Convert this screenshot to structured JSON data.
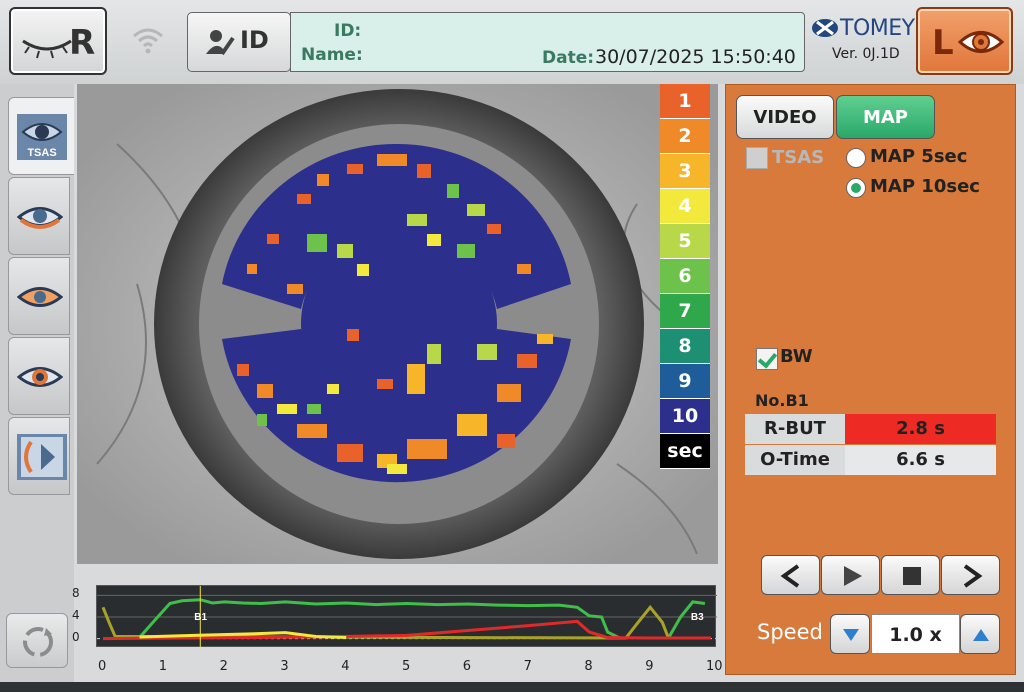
{
  "header": {
    "right_eye_label": "R",
    "left_eye_label": "L",
    "id_button_label": "ID",
    "id_label": "ID:",
    "name_label": "Name:",
    "id_value": "",
    "name_value": "",
    "date_label": "Date:",
    "date_value": "30/07/2025 15:50:40",
    "brand": "TOMEY",
    "version": "Ver. 0J.1D"
  },
  "sidebar": {
    "tsas_label": "TSAS",
    "tools": [
      "tsas-tool-icon",
      "eye-upper-icon",
      "eye-lower-icon",
      "eye-iris-icon",
      "video-meibo-icon"
    ]
  },
  "legend": {
    "items": [
      {
        "label": "1",
        "color": "#e8622a"
      },
      {
        "label": "2",
        "color": "#f08a28"
      },
      {
        "label": "3",
        "color": "#f7b52a"
      },
      {
        "label": "4",
        "color": "#f3e83c"
      },
      {
        "label": "5",
        "color": "#b8d84a"
      },
      {
        "label": "6",
        "color": "#6cc24a"
      },
      {
        "label": "7",
        "color": "#2ea84a"
      },
      {
        "label": "8",
        "color": "#1d8f72"
      },
      {
        "label": "9",
        "color": "#1f5d9a"
      },
      {
        "label": "10",
        "color": "#2d2f8c"
      },
      {
        "label": "sec",
        "color": "#000000"
      }
    ]
  },
  "mode": {
    "video_label": "VIDEO",
    "map_label": "MAP",
    "tsas_label": "TSAS",
    "map5_label": "MAP 5sec",
    "map10_label": "MAP 10sec",
    "selected": "MAP 10sec"
  },
  "bw": {
    "label": "BW",
    "checked": true
  },
  "results": {
    "no_label": "No.B1",
    "rbut_label": "R-BUT",
    "rbut_value": "2.8 s",
    "otime_label": "O-Time",
    "otime_value": "6.6 s"
  },
  "speed": {
    "label": "Speed",
    "value": "1.0 x"
  },
  "chart_data": {
    "type": "line",
    "x_ticks": [
      "0",
      "1",
      "2",
      "3",
      "4",
      "5",
      "6",
      "7",
      "8",
      "9",
      "10"
    ],
    "y_ticks": [
      "8",
      "4",
      "0"
    ],
    "xlim": [
      0,
      10
    ],
    "ylim": [
      -1,
      9
    ],
    "markers": [
      {
        "label": "B1",
        "x": 1.6
      },
      {
        "label": "B3",
        "x": 9.9
      }
    ],
    "series": [
      {
        "color": "#3fbf4a",
        "values": [
          [
            0.6,
            0.2
          ],
          [
            0.9,
            4
          ],
          [
            1.1,
            6.5
          ],
          [
            1.3,
            7
          ],
          [
            1.6,
            7.2
          ],
          [
            1.8,
            6.6
          ],
          [
            2,
            6.8
          ],
          [
            2.3,
            6.6
          ],
          [
            2.6,
            6.5
          ],
          [
            3,
            6.8
          ],
          [
            3.5,
            6.4
          ],
          [
            4,
            6.6
          ],
          [
            4.5,
            6.3
          ],
          [
            5,
            6.5
          ],
          [
            5.5,
            6.3
          ],
          [
            6,
            6.4
          ],
          [
            6.5,
            6.2
          ],
          [
            7,
            6.1
          ],
          [
            7.5,
            6.2
          ],
          [
            7.8,
            5.8
          ],
          [
            8,
            4.2
          ],
          [
            8.2,
            4.0
          ],
          [
            8.3,
            1.2
          ],
          [
            8.5,
            0.1
          ],
          [
            8.6,
            0.1
          ]
        ]
      },
      {
        "color": "#3fbf4a",
        "values": [
          [
            9.3,
            0.1
          ],
          [
            9.5,
            4
          ],
          [
            9.7,
            6.8
          ],
          [
            9.9,
            6.5
          ]
        ]
      },
      {
        "color": "#a8a22a",
        "values": [
          [
            0,
            5.8
          ],
          [
            0.1,
            3
          ],
          [
            0.2,
            0.4
          ],
          [
            8.6,
            0.1
          ],
          [
            8.8,
            3
          ],
          [
            9,
            5.8
          ],
          [
            9.2,
            3
          ],
          [
            9.3,
            0.1
          ]
        ]
      },
      {
        "color": "#e02a2a",
        "values": [
          [
            0,
            0
          ],
          [
            3.5,
            0.3
          ],
          [
            5,
            0.6
          ],
          [
            6,
            1.5
          ],
          [
            7,
            2.4
          ],
          [
            7.5,
            2.9
          ],
          [
            7.8,
            3.2
          ],
          [
            8,
            1.2
          ],
          [
            8.3,
            0.2
          ],
          [
            9,
            0.1
          ],
          [
            10,
            0.1
          ]
        ]
      },
      {
        "color": "#f3e83c",
        "values": [
          [
            0.6,
            0.3
          ],
          [
            1.5,
            0.6
          ],
          [
            2.5,
            0.9
          ],
          [
            3,
            1.1
          ],
          [
            3.5,
            0.4
          ],
          [
            4,
            0.2
          ]
        ]
      }
    ]
  }
}
